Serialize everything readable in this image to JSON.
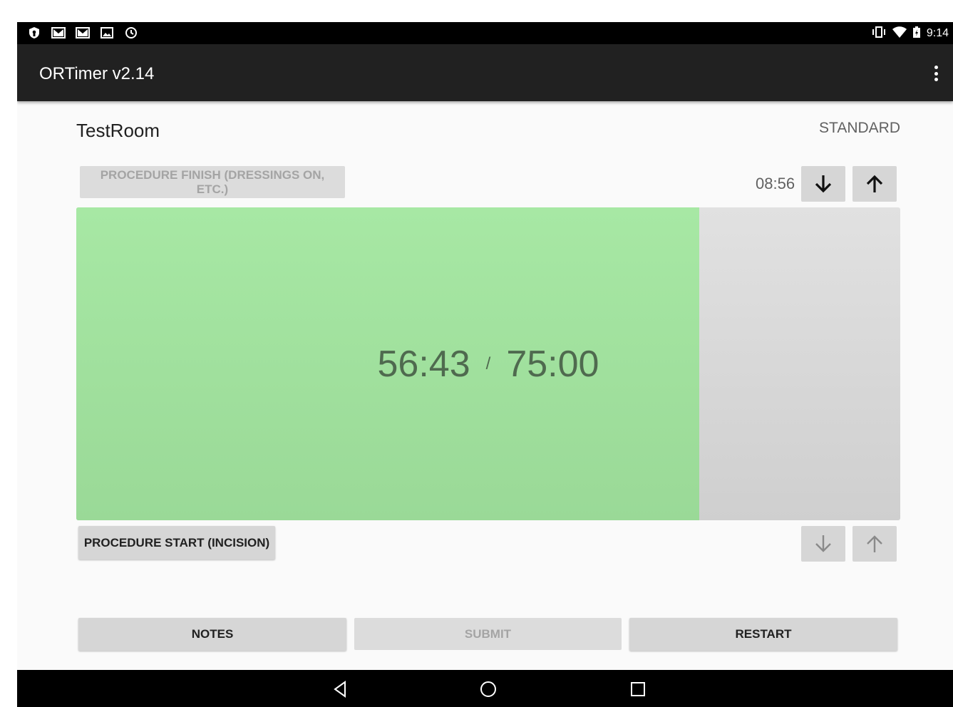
{
  "status_bar": {
    "left_icons": [
      "shield-icon",
      "gmail-icon",
      "gmail-icon",
      "image-icon",
      "sync-icon"
    ],
    "right_icons": [
      "vibrate-icon",
      "wifi-icon",
      "battery-charging-icon"
    ],
    "time": "9:14"
  },
  "toolbar": {
    "title": "ORTimer v2.14",
    "overflow_icon": "more-vert-icon"
  },
  "room": {
    "name": "TestRoom",
    "mode": "STANDARD"
  },
  "finish": {
    "label": "PROCEDURE FINISH (DRESSINGS ON, ETC.)",
    "time": "08:56",
    "enabled": false
  },
  "timer": {
    "elapsed": "56:43",
    "separator": "/",
    "total": "75:00",
    "progress": 0.7562,
    "fill_color": "#a4e4a1"
  },
  "start": {
    "label": "PROCEDURE START (INCISION)",
    "enabled": true
  },
  "actions": {
    "notes": "NOTES",
    "submit": "SUBMIT",
    "restart": "RESTART"
  },
  "nav_bar": {
    "icons": [
      "back-icon",
      "home-icon",
      "recents-icon"
    ]
  }
}
